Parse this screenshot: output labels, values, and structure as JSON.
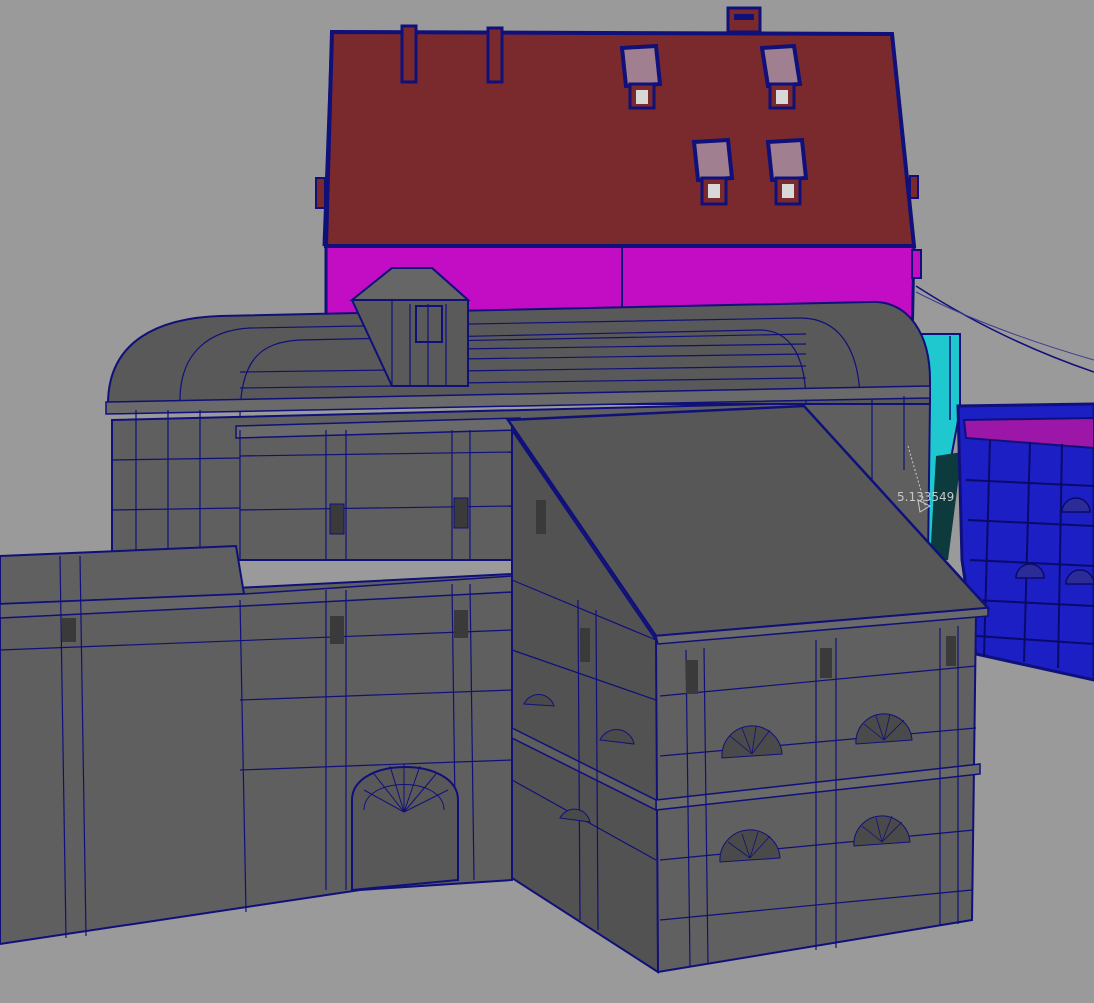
{
  "viewport": {
    "background_color": "#9a9a9a"
  },
  "measurement": {
    "distance_readout": "5.133549"
  },
  "colors": {
    "roof_red": "#7a2a2c",
    "wall_magenta": "#c20dc4",
    "wireframe_edge": "#10107a",
    "building_gray": "#5f5f5f",
    "building_gray_dark": "#4b4b4b",
    "roof_gray": "#575757",
    "cyan_object": "#1fc7cf",
    "blue_object": "#1b1fc4"
  },
  "scene_objects": [
    {
      "label": "house-red-roof"
    },
    {
      "label": "house-magenta-wall"
    },
    {
      "label": "gray-fortress-building"
    },
    {
      "label": "gray-annex-building"
    },
    {
      "label": "gray-long-wall"
    },
    {
      "label": "cyan-object"
    },
    {
      "label": "blue-grid-object"
    }
  ]
}
